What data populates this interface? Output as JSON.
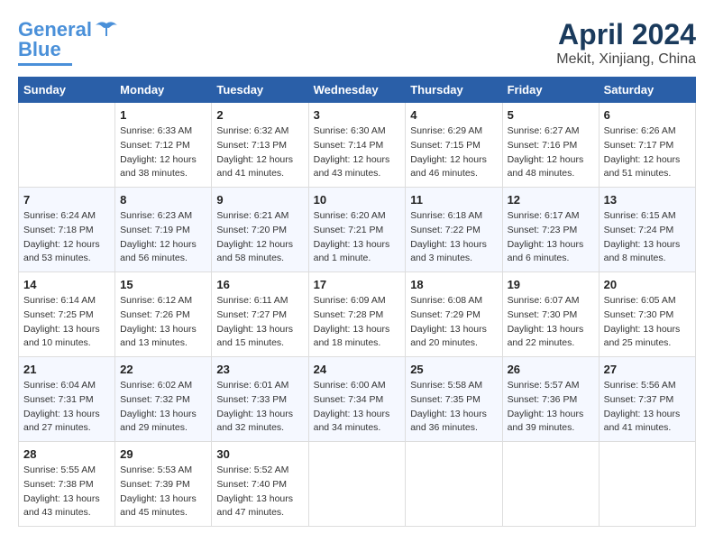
{
  "logo": {
    "line1": "General",
    "line2": "Blue"
  },
  "title": "April 2024",
  "subtitle": "Mekit, Xinjiang, China",
  "headers": [
    "Sunday",
    "Monday",
    "Tuesday",
    "Wednesday",
    "Thursday",
    "Friday",
    "Saturday"
  ],
  "weeks": [
    [
      {
        "day": "",
        "sunrise": "",
        "sunset": "",
        "daylight": ""
      },
      {
        "day": "1",
        "sunrise": "Sunrise: 6:33 AM",
        "sunset": "Sunset: 7:12 PM",
        "daylight": "Daylight: 12 hours and 38 minutes."
      },
      {
        "day": "2",
        "sunrise": "Sunrise: 6:32 AM",
        "sunset": "Sunset: 7:13 PM",
        "daylight": "Daylight: 12 hours and 41 minutes."
      },
      {
        "day": "3",
        "sunrise": "Sunrise: 6:30 AM",
        "sunset": "Sunset: 7:14 PM",
        "daylight": "Daylight: 12 hours and 43 minutes."
      },
      {
        "day": "4",
        "sunrise": "Sunrise: 6:29 AM",
        "sunset": "Sunset: 7:15 PM",
        "daylight": "Daylight: 12 hours and 46 minutes."
      },
      {
        "day": "5",
        "sunrise": "Sunrise: 6:27 AM",
        "sunset": "Sunset: 7:16 PM",
        "daylight": "Daylight: 12 hours and 48 minutes."
      },
      {
        "day": "6",
        "sunrise": "Sunrise: 6:26 AM",
        "sunset": "Sunset: 7:17 PM",
        "daylight": "Daylight: 12 hours and 51 minutes."
      }
    ],
    [
      {
        "day": "7",
        "sunrise": "Sunrise: 6:24 AM",
        "sunset": "Sunset: 7:18 PM",
        "daylight": "Daylight: 12 hours and 53 minutes."
      },
      {
        "day": "8",
        "sunrise": "Sunrise: 6:23 AM",
        "sunset": "Sunset: 7:19 PM",
        "daylight": "Daylight: 12 hours and 56 minutes."
      },
      {
        "day": "9",
        "sunrise": "Sunrise: 6:21 AM",
        "sunset": "Sunset: 7:20 PM",
        "daylight": "Daylight: 12 hours and 58 minutes."
      },
      {
        "day": "10",
        "sunrise": "Sunrise: 6:20 AM",
        "sunset": "Sunset: 7:21 PM",
        "daylight": "Daylight: 13 hours and 1 minute."
      },
      {
        "day": "11",
        "sunrise": "Sunrise: 6:18 AM",
        "sunset": "Sunset: 7:22 PM",
        "daylight": "Daylight: 13 hours and 3 minutes."
      },
      {
        "day": "12",
        "sunrise": "Sunrise: 6:17 AM",
        "sunset": "Sunset: 7:23 PM",
        "daylight": "Daylight: 13 hours and 6 minutes."
      },
      {
        "day": "13",
        "sunrise": "Sunrise: 6:15 AM",
        "sunset": "Sunset: 7:24 PM",
        "daylight": "Daylight: 13 hours and 8 minutes."
      }
    ],
    [
      {
        "day": "14",
        "sunrise": "Sunrise: 6:14 AM",
        "sunset": "Sunset: 7:25 PM",
        "daylight": "Daylight: 13 hours and 10 minutes."
      },
      {
        "day": "15",
        "sunrise": "Sunrise: 6:12 AM",
        "sunset": "Sunset: 7:26 PM",
        "daylight": "Daylight: 13 hours and 13 minutes."
      },
      {
        "day": "16",
        "sunrise": "Sunrise: 6:11 AM",
        "sunset": "Sunset: 7:27 PM",
        "daylight": "Daylight: 13 hours and 15 minutes."
      },
      {
        "day": "17",
        "sunrise": "Sunrise: 6:09 AM",
        "sunset": "Sunset: 7:28 PM",
        "daylight": "Daylight: 13 hours and 18 minutes."
      },
      {
        "day": "18",
        "sunrise": "Sunrise: 6:08 AM",
        "sunset": "Sunset: 7:29 PM",
        "daylight": "Daylight: 13 hours and 20 minutes."
      },
      {
        "day": "19",
        "sunrise": "Sunrise: 6:07 AM",
        "sunset": "Sunset: 7:30 PM",
        "daylight": "Daylight: 13 hours and 22 minutes."
      },
      {
        "day": "20",
        "sunrise": "Sunrise: 6:05 AM",
        "sunset": "Sunset: 7:30 PM",
        "daylight": "Daylight: 13 hours and 25 minutes."
      }
    ],
    [
      {
        "day": "21",
        "sunrise": "Sunrise: 6:04 AM",
        "sunset": "Sunset: 7:31 PM",
        "daylight": "Daylight: 13 hours and 27 minutes."
      },
      {
        "day": "22",
        "sunrise": "Sunrise: 6:02 AM",
        "sunset": "Sunset: 7:32 PM",
        "daylight": "Daylight: 13 hours and 29 minutes."
      },
      {
        "day": "23",
        "sunrise": "Sunrise: 6:01 AM",
        "sunset": "Sunset: 7:33 PM",
        "daylight": "Daylight: 13 hours and 32 minutes."
      },
      {
        "day": "24",
        "sunrise": "Sunrise: 6:00 AM",
        "sunset": "Sunset: 7:34 PM",
        "daylight": "Daylight: 13 hours and 34 minutes."
      },
      {
        "day": "25",
        "sunrise": "Sunrise: 5:58 AM",
        "sunset": "Sunset: 7:35 PM",
        "daylight": "Daylight: 13 hours and 36 minutes."
      },
      {
        "day": "26",
        "sunrise": "Sunrise: 5:57 AM",
        "sunset": "Sunset: 7:36 PM",
        "daylight": "Daylight: 13 hours and 39 minutes."
      },
      {
        "day": "27",
        "sunrise": "Sunrise: 5:56 AM",
        "sunset": "Sunset: 7:37 PM",
        "daylight": "Daylight: 13 hours and 41 minutes."
      }
    ],
    [
      {
        "day": "28",
        "sunrise": "Sunrise: 5:55 AM",
        "sunset": "Sunset: 7:38 PM",
        "daylight": "Daylight: 13 hours and 43 minutes."
      },
      {
        "day": "29",
        "sunrise": "Sunrise: 5:53 AM",
        "sunset": "Sunset: 7:39 PM",
        "daylight": "Daylight: 13 hours and 45 minutes."
      },
      {
        "day": "30",
        "sunrise": "Sunrise: 5:52 AM",
        "sunset": "Sunset: 7:40 PM",
        "daylight": "Daylight: 13 hours and 47 minutes."
      },
      {
        "day": "",
        "sunrise": "",
        "sunset": "",
        "daylight": ""
      },
      {
        "day": "",
        "sunrise": "",
        "sunset": "",
        "daylight": ""
      },
      {
        "day": "",
        "sunrise": "",
        "sunset": "",
        "daylight": ""
      },
      {
        "day": "",
        "sunrise": "",
        "sunset": "",
        "daylight": ""
      }
    ]
  ]
}
